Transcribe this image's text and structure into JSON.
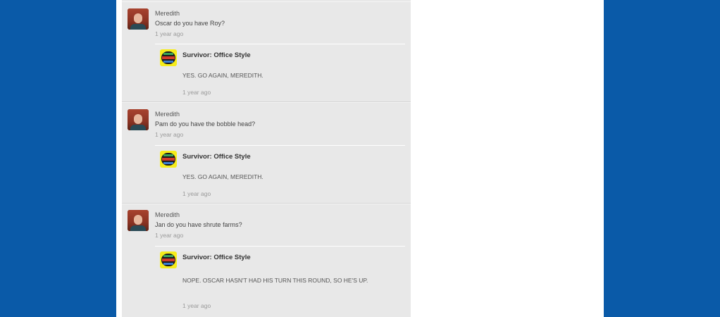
{
  "posts": [
    {
      "author": "Meredith",
      "text": "Oscar do you have Roy?",
      "time": "1 year ago",
      "reply": {
        "author": "Survivor: Office Style",
        "text": "YES.  GO AGAIN, MEREDITH.",
        "time": "1 year ago"
      }
    },
    {
      "author": "Meredith",
      "text": "Pam do you have the bobble head?",
      "time": "1 year ago",
      "reply": {
        "author": "Survivor: Office Style",
        "text": "YES.  GO AGAIN, MEREDITH.",
        "time": "1 year ago"
      }
    },
    {
      "author": "Meredith",
      "text": "Jan do you have shrute farms?",
      "time": "1 year ago",
      "reply": {
        "author": "Survivor: Office Style",
        "text": "NOPE.  OSCAR HASN'T HAD HIS TURN THIS ROUND, SO HE'S UP.",
        "time": "1 year ago"
      }
    }
  ],
  "icons": {
    "user_avatar": "meredith-avatar",
    "page_avatar": "survivor-logo-avatar"
  },
  "colors": {
    "page_background": "#0a5aa8",
    "feed_background": "#e8e8e8"
  }
}
